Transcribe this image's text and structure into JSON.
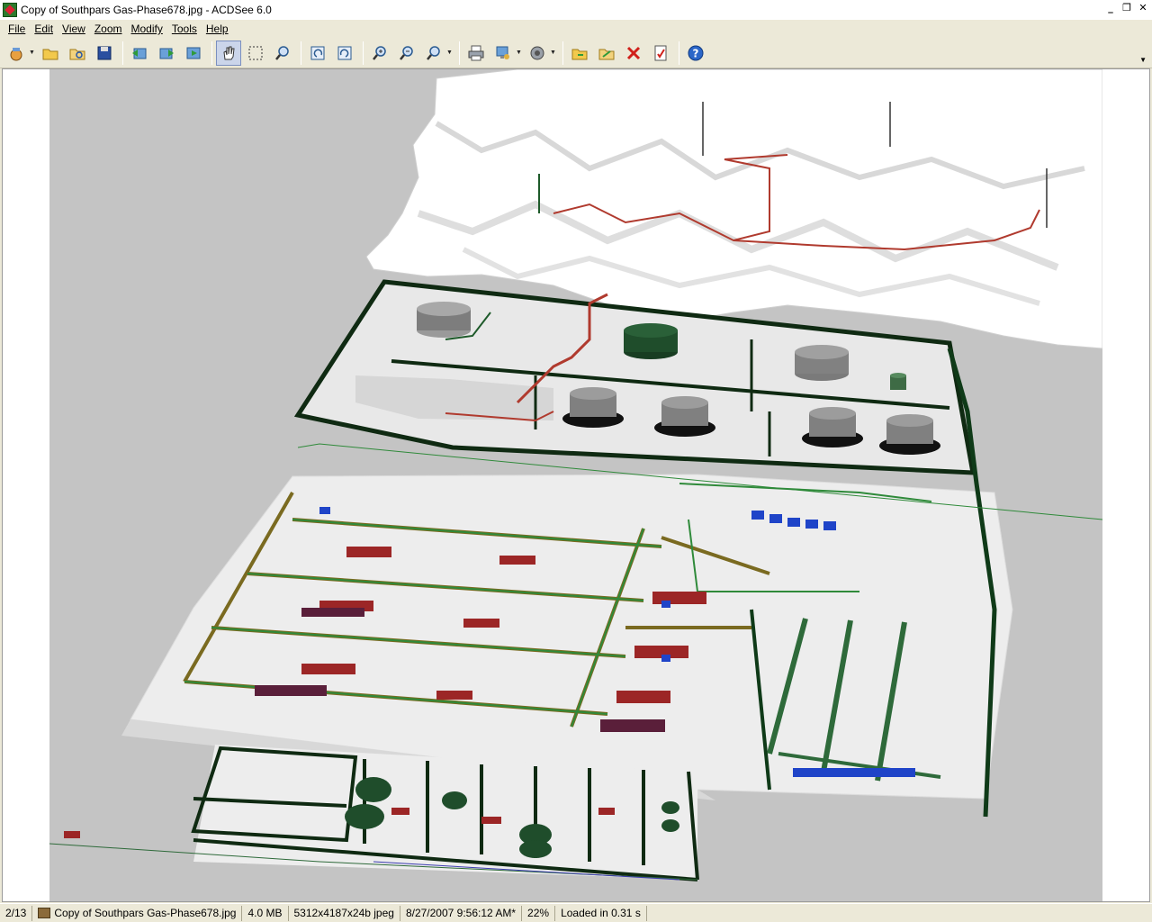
{
  "window": {
    "title": "Copy of Southpars Gas-Phase678.jpg - ACDSee 6.0"
  },
  "menu": [
    {
      "id": "file",
      "label": "File"
    },
    {
      "id": "edit",
      "label": "Edit"
    },
    {
      "id": "view",
      "label": "View"
    },
    {
      "id": "zoom",
      "label": "Zoom"
    },
    {
      "id": "modify",
      "label": "Modify"
    },
    {
      "id": "tools",
      "label": "Tools"
    },
    {
      "id": "help",
      "label": "Help"
    }
  ],
  "toolbar": {
    "buttons": [
      {
        "name": "acquire-icon",
        "dropdown": true
      },
      {
        "name": "open-folder-icon"
      },
      {
        "name": "browse-icon"
      },
      {
        "name": "save-icon"
      },
      {
        "sep": true
      },
      {
        "name": "previous-image-icon"
      },
      {
        "name": "next-image-icon"
      },
      {
        "name": "slideshow-icon"
      },
      {
        "sep": true
      },
      {
        "name": "hand-pan-icon",
        "active": true
      },
      {
        "name": "selection-icon"
      },
      {
        "name": "zoom-tool-icon"
      },
      {
        "sep": true
      },
      {
        "name": "rotate-left-icon"
      },
      {
        "name": "rotate-right-icon"
      },
      {
        "sep": true
      },
      {
        "name": "zoom-in-icon"
      },
      {
        "name": "zoom-out-icon"
      },
      {
        "name": "zoom-fit-icon",
        "dropdown": true
      },
      {
        "sep": true
      },
      {
        "name": "print-icon"
      },
      {
        "name": "set-wallpaper-icon",
        "dropdown": true
      },
      {
        "name": "audio-icon",
        "dropdown": true
      },
      {
        "sep": true
      },
      {
        "name": "copy-to-folder-icon"
      },
      {
        "name": "move-to-folder-icon"
      },
      {
        "name": "delete-icon"
      },
      {
        "name": "properties-icon"
      },
      {
        "sep": true
      },
      {
        "name": "help-icon"
      }
    ]
  },
  "status": {
    "position": "2/13",
    "filename": "Copy of Southpars Gas-Phase678.jpg",
    "filesize": "4.0 MB",
    "dimensions": "5312x4187x24b jpeg",
    "modified": "8/27/2007 9:56:12 AM*",
    "zoom": "22%",
    "load_time": "Loaded in 0.31 s"
  },
  "colors": {
    "pipe_green": "#1e5a2a",
    "pipe_red": "#b03a2e",
    "tank_gray": "#808080",
    "tank_green": "#1f4d2b",
    "equipment_blue": "#1f44c8",
    "building_maroon": "#5a1f3a"
  }
}
